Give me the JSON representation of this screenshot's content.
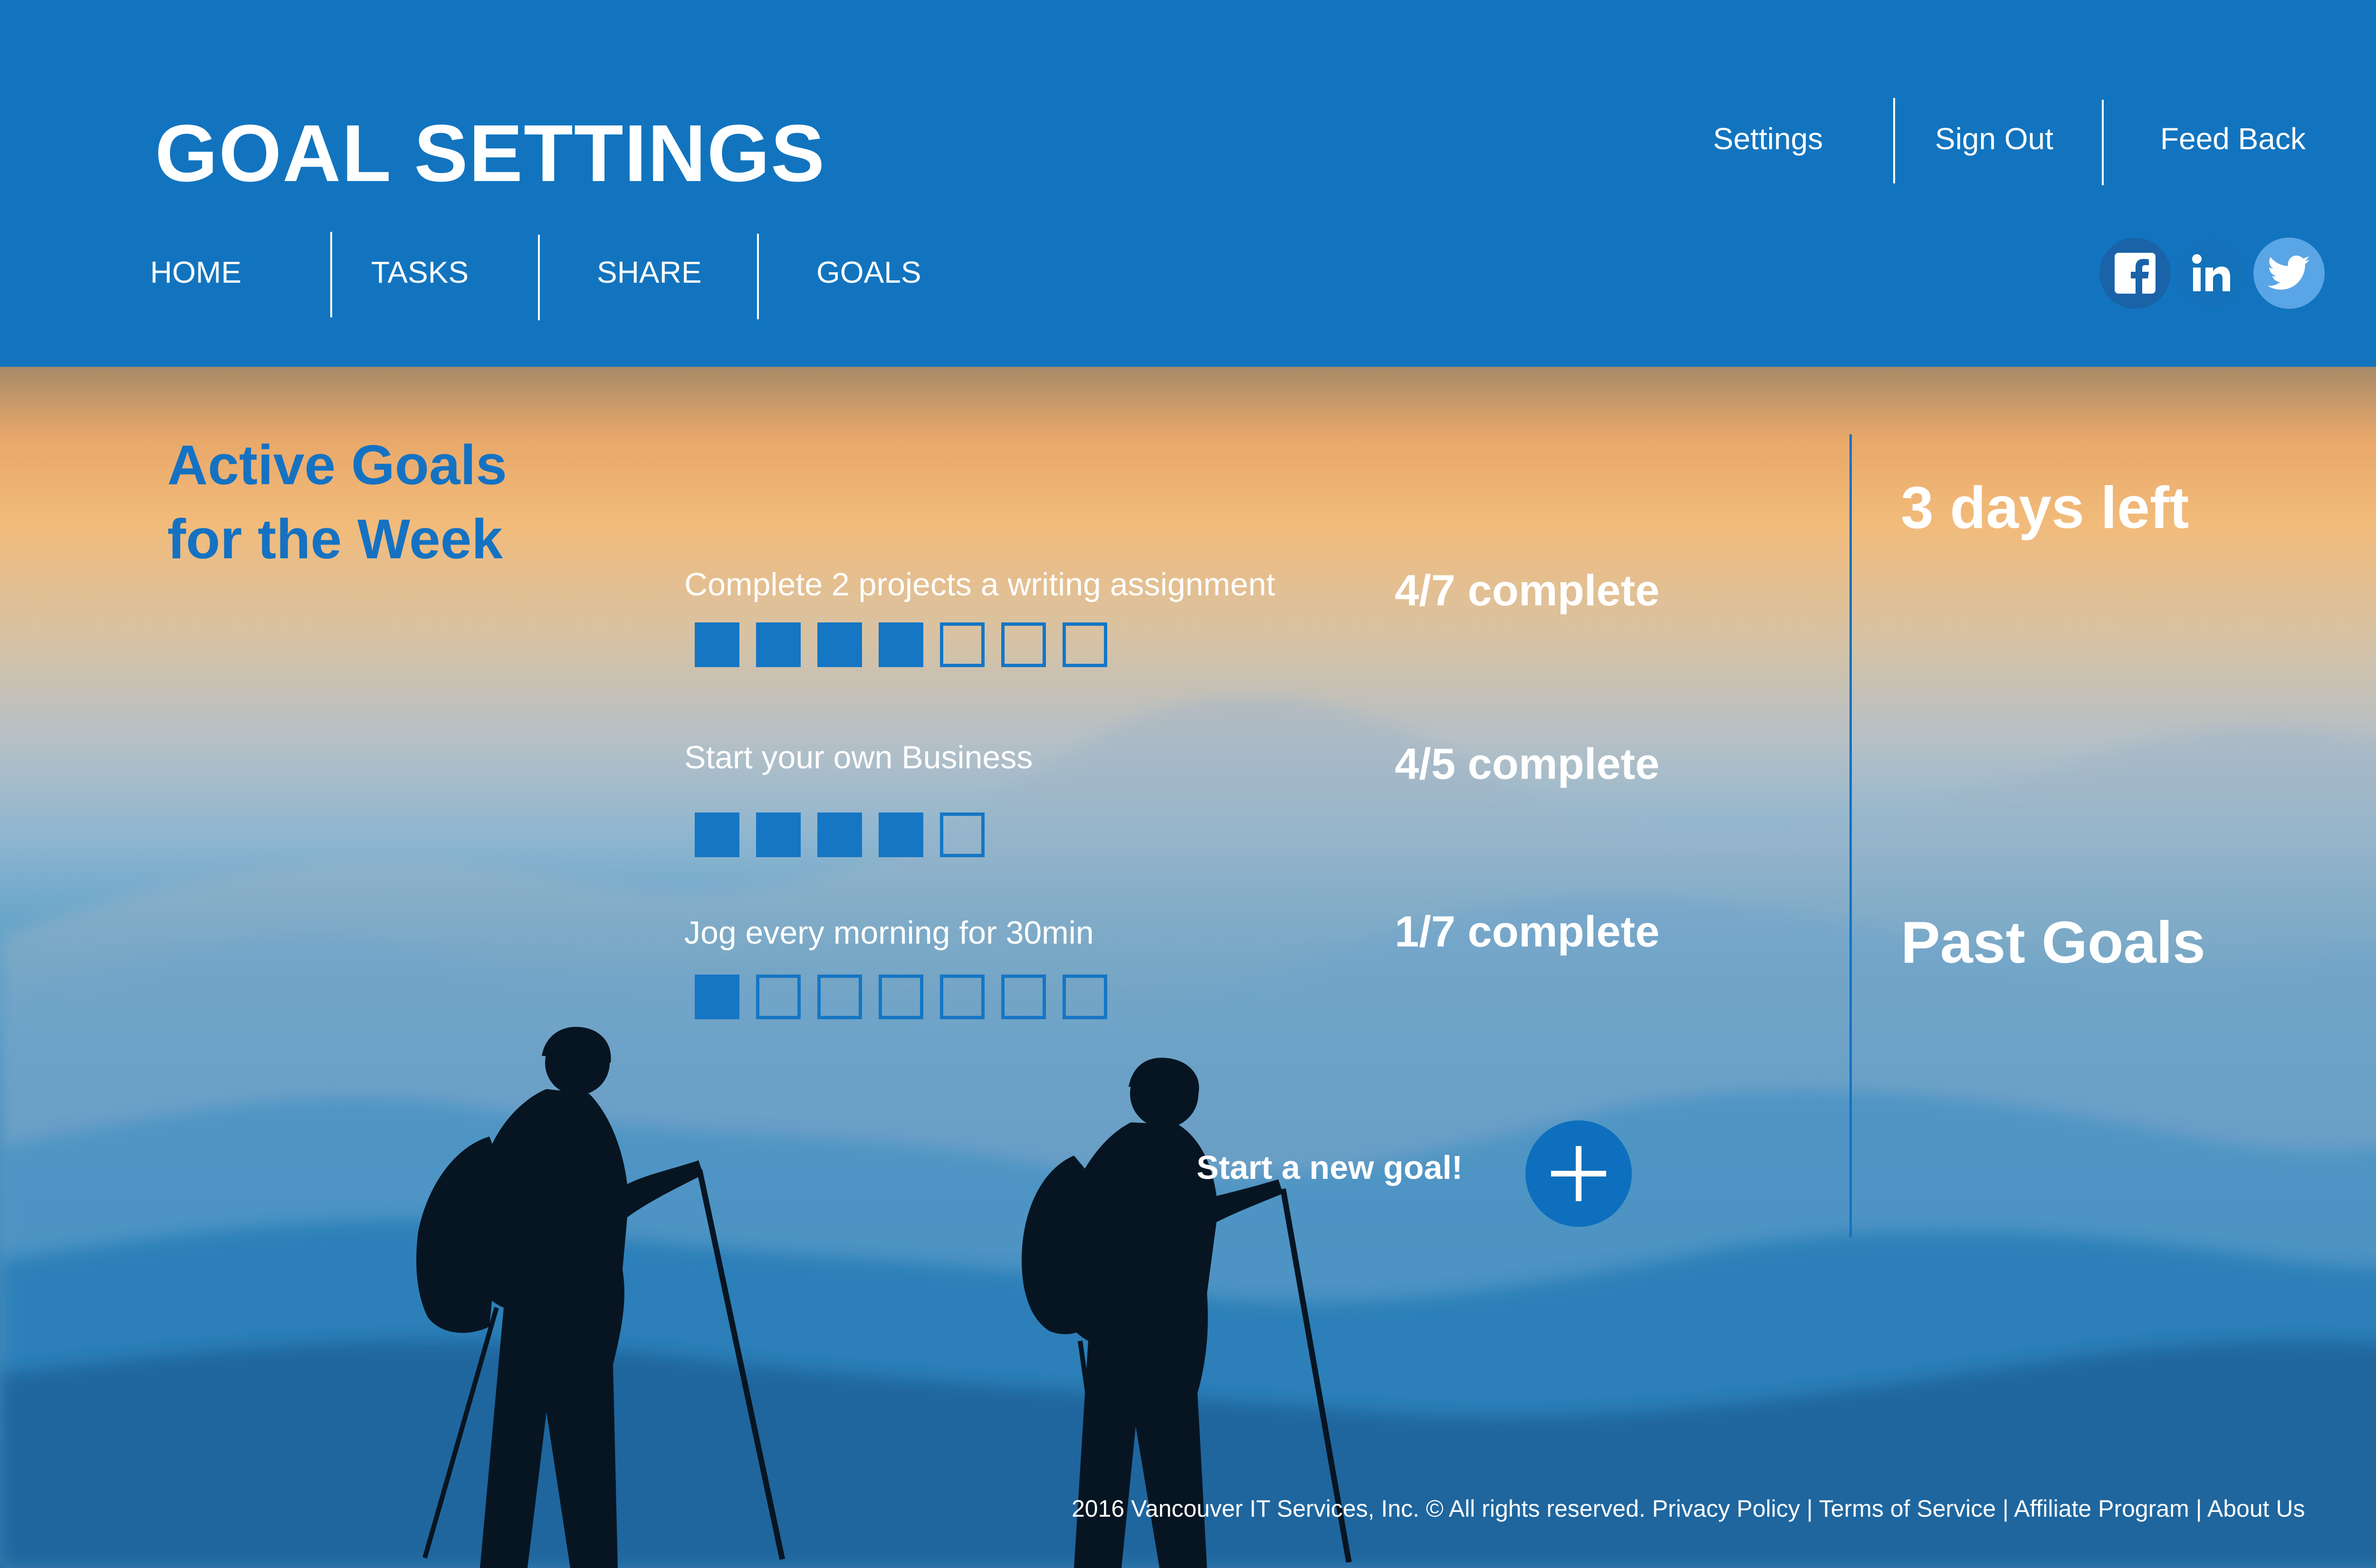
{
  "header": {
    "title": "GOAL SETTINGS",
    "nav": [
      "HOME",
      "TASKS",
      "SHARE",
      "GOALS"
    ],
    "utility_links": [
      "Settings",
      "Sign Out",
      "Feed Back"
    ],
    "social_icons": [
      "facebook-icon",
      "linkedin-icon",
      "twitter-icon"
    ]
  },
  "main": {
    "section_title_line1": "Active Goals",
    "section_title_line2": "for the Week",
    "goals": [
      {
        "label": "Complete 2 projects a writing assignment",
        "status": "4/7 complete",
        "done": 4,
        "total": 7
      },
      {
        "label": "Start your own Business",
        "status": "4/5 complete",
        "done": 4,
        "total": 5
      },
      {
        "label": "Jog every morning for 30min",
        "status": "1/7 complete",
        "done": 1,
        "total": 7
      }
    ],
    "new_goal_label": "Start a new goal!"
  },
  "sidebar": {
    "days_left": "3 days left",
    "past_goals": "Past Goals"
  },
  "footer": {
    "copyright": "2016 Vancouver IT Services, Inc. © All rights reserved.",
    "links": [
      "Privacy Policy",
      "Terms of Service",
      "Affiliate Program",
      "About Us"
    ]
  },
  "colors": {
    "primary_blue": "#1274bf",
    "progress_blue": "#1576c4",
    "white": "#ffffff"
  }
}
